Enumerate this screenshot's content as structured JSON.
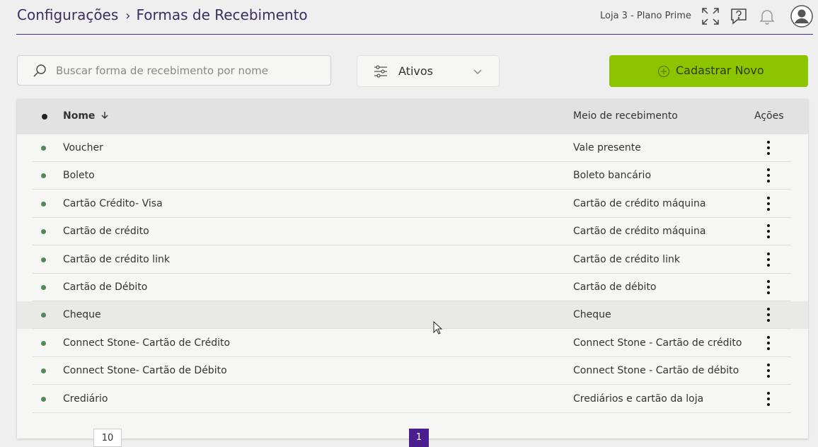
{
  "header": {
    "breadcrumb_root": "Configurações",
    "breadcrumb_current": "Formas de Recebimento",
    "store_plan": "Loja 3 - Plano Prime"
  },
  "toolbar": {
    "search_placeholder": "Buscar forma de recebimento por nome",
    "filter_value": "Ativos",
    "new_button_label": "Cadastrar Novo"
  },
  "table": {
    "columns": {
      "name": "Nome",
      "method": "Meio de recebimento",
      "actions": "Ações"
    },
    "rows": [
      {
        "name": "Voucher",
        "method": "Vale presente"
      },
      {
        "name": "Boleto",
        "method": "Boleto bancário"
      },
      {
        "name": "Cartão Crédito- Visa",
        "method": "Cartão de crédito máquina"
      },
      {
        "name": "Cartão de crédito",
        "method": "Cartão de crédito máquina"
      },
      {
        "name": "Cartão de crédito link",
        "method": "Cartão de crédito link"
      },
      {
        "name": "Cartão de Débito",
        "method": "Cartão de débito"
      },
      {
        "name": "Cheque",
        "method": "Cheque"
      },
      {
        "name": "Connect Stone- Cartão de Crédito",
        "method": "Connect Stone - Cartão de crédito"
      },
      {
        "name": "Connect Stone- Cartão de Débito",
        "method": "Connect Stone - Cartão de débito"
      },
      {
        "name": "Crediário",
        "method": "Crediários e cartão da loja"
      }
    ]
  },
  "pagination": {
    "per_page": "10",
    "current_page": "1"
  },
  "colors": {
    "accent": "#4b1d8f",
    "primary_button": "#8cc400",
    "status_active": "#4e8a5c"
  }
}
